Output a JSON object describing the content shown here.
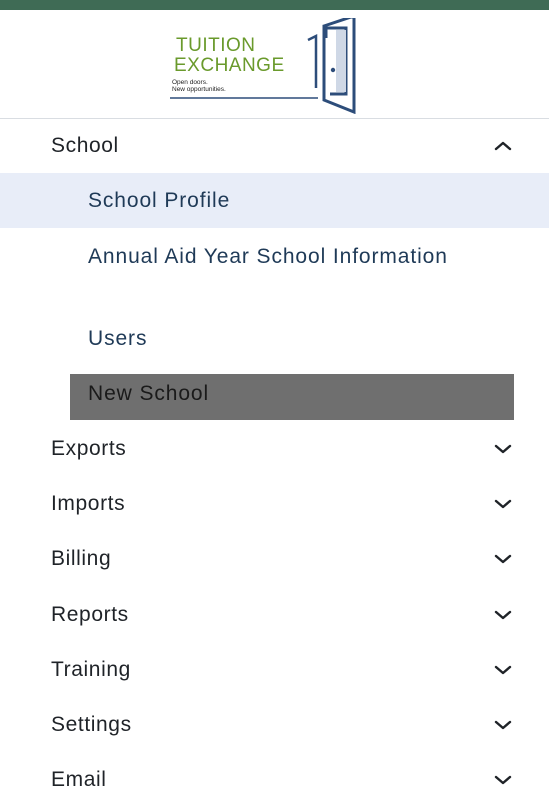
{
  "logo": {
    "line1": "TUITION",
    "line2": "EXCHANGE",
    "tagline1": "Open doors.",
    "tagline2": "New opportunities.",
    "colors": {
      "green": "#6a9a2c",
      "blue": "#2d4d7a"
    }
  },
  "nav": {
    "school": {
      "label": "School",
      "icon": "chevron-up-icon",
      "expanded": true
    },
    "school_items": [
      {
        "label": "School Profile",
        "active": true
      },
      {
        "label": "Annual Aid Year School Information"
      },
      {
        "label": "Users"
      },
      {
        "label": "New School",
        "highlighted": true
      }
    ],
    "sections": [
      {
        "label": "Exports",
        "icon": "chevron-down-icon"
      },
      {
        "label": "Imports",
        "icon": "chevron-down-icon"
      },
      {
        "label": "Billing",
        "icon": "chevron-down-icon"
      },
      {
        "label": "Reports",
        "icon": "chevron-down-icon"
      },
      {
        "label": "Training",
        "icon": "chevron-down-icon"
      },
      {
        "label": "Settings",
        "icon": "chevron-down-icon"
      },
      {
        "label": "Email",
        "icon": "chevron-down-icon"
      }
    ]
  },
  "colors": {
    "top_bar": "#3f6b55",
    "active_bg": "#e8edf8",
    "highlight_bg": "#6f6f6f"
  }
}
